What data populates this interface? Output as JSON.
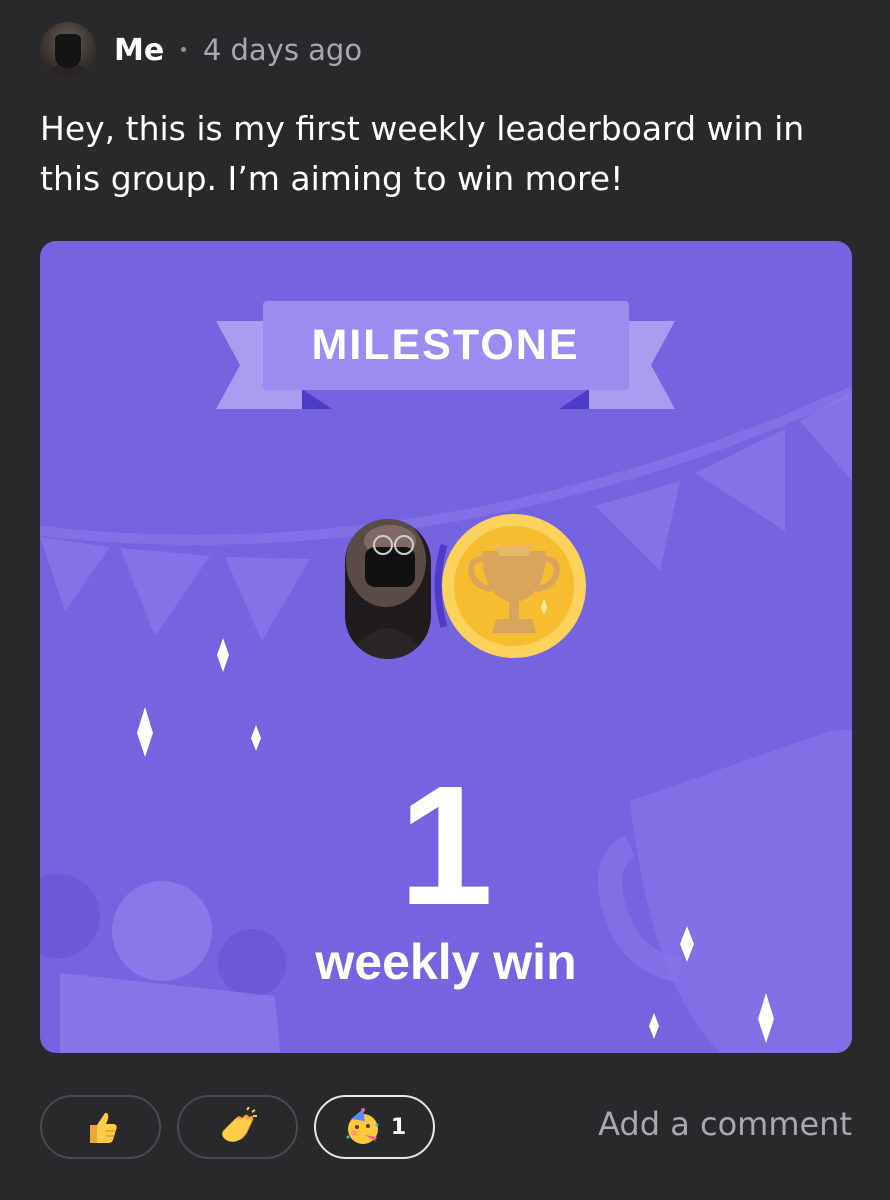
{
  "post": {
    "author": "Me",
    "separator": "•",
    "time": "4 days ago",
    "text": "Hey, this is my first weekly leaderboard win in this group. I’m aiming to win more!"
  },
  "card": {
    "ribbon_label": "MILESTONE",
    "number": "1",
    "caption": "weekly win",
    "colors": {
      "background": "#7563e0",
      "ribbon": "#9a8cf0",
      "coin": "#f7bd31"
    }
  },
  "reactions": [
    {
      "name": "thumbs-up",
      "count": ""
    },
    {
      "name": "clapping-hands",
      "count": ""
    },
    {
      "name": "party-face",
      "count": "1"
    }
  ],
  "add_comment_label": "Add a comment"
}
